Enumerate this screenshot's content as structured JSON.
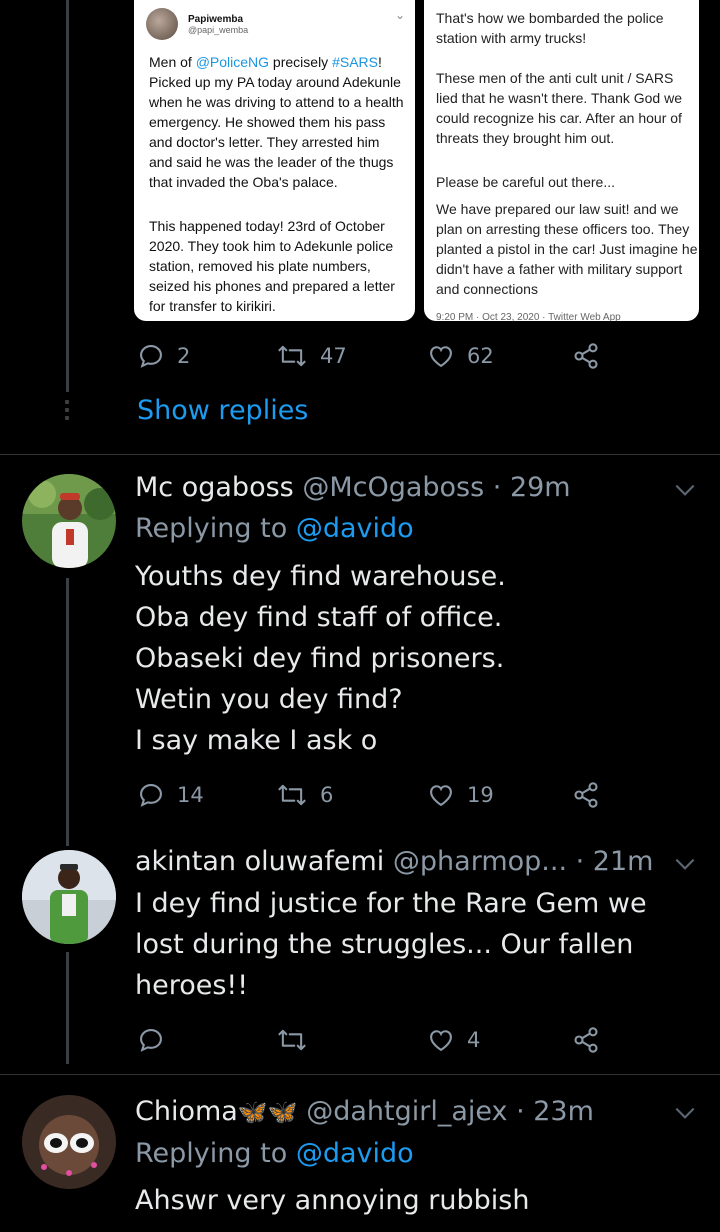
{
  "tweet1": {
    "left_card": {
      "name": "Papiwemba",
      "handle": "@papi_wemba",
      "para1_parts": [
        "Men of ",
        "@PoliceNG",
        " precisely ",
        "#SARS",
        "! Picked up my PA today around Adekunle when he was driving to attend to a health emergency. He showed them his pass and doctor's letter. They arrested him and said he was the leader of the thugs that invaded the Oba's palace."
      ],
      "para2": "This happened today! 23rd of October 2020. They took him to Adekunle police station, removed his plate numbers, seized his phones and prepared a letter for transfer to kirikiri."
    },
    "right_card": {
      "para1": "That's how we bombarded the police station with army trucks!",
      "para2": "These men of the anti cult unit / SARS lied that he wasn't there. Thank God we could recognize his car. After an hour of threats they brought him out.",
      "para3": "Please be careful out there...",
      "para4": "We have prepared our law suit! and we plan on arresting these officers too. They planted a pistol in the car! Just imagine he didn't have a father with military support and connections",
      "meta": "9:20 PM · Oct 23, 2020 · Twitter Web App"
    },
    "replies": "2",
    "retweets": "47",
    "likes": "62",
    "show_replies": "Show replies"
  },
  "tweet2": {
    "name": "Mc ogaboss",
    "handle": "@McOgaboss",
    "time": "· 29m",
    "replying_prefix": "Replying to ",
    "replying_to": "@davido",
    "lines": [
      "Youths dey find warehouse.",
      "Oba dey find staff of office.",
      "Obaseki dey find prisoners.",
      "Wetin you dey find?",
      "I say make I ask o"
    ],
    "replies": "14",
    "retweets": "6",
    "likes": "19"
  },
  "tweet3": {
    "name": "akintan oluwafemi",
    "handle": "@pharmop...",
    "time": "· 21m",
    "lines": [
      "I dey find justice for the Rare Gem we",
      "lost during the struggles... Our fallen",
      "heroes!!"
    ],
    "replies": "",
    "retweets": "",
    "likes": "4"
  },
  "tweet4": {
    "name": "Chioma",
    "emoji": "🦋🦋",
    "handle": "@dahtgirl_ajex",
    "time": "· 23m",
    "replying_prefix": "Replying to ",
    "replying_to": "@davido",
    "lines": [
      "Ahswr very annoying rubbish"
    ]
  },
  "icons": {
    "reply": "reply-icon",
    "retweet": "retweet-icon",
    "like": "heart-icon",
    "share": "share-icon",
    "menu": "chevron-down-icon"
  },
  "colors": {
    "background": "#000000",
    "text": "#e7e9ea",
    "muted": "#8b98a5",
    "accent": "#1d9bf0"
  }
}
